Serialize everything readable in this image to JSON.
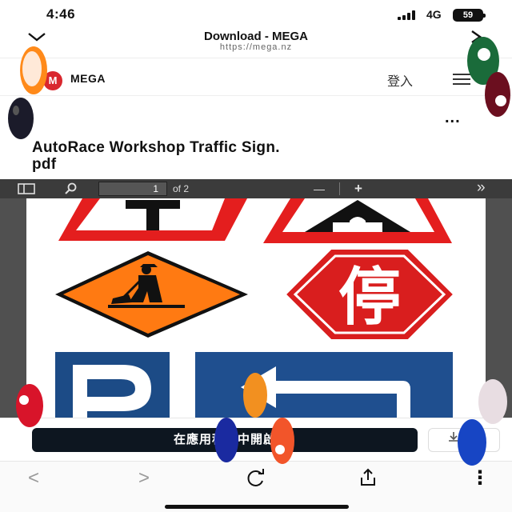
{
  "status_bar": {
    "time": "4:46",
    "network": "4G",
    "battery": "59"
  },
  "browser_header": {
    "title": "Download - MEGA",
    "url": "https://mega.nz",
    "left_icon": "chevron-down-icon",
    "right_icon": "chevron-right-icon"
  },
  "site_nav": {
    "logo_letter": "M",
    "brand": "MEGA",
    "login": "登入",
    "menu_icon": "hamburger-icon"
  },
  "file": {
    "more": "...",
    "title": "AutoRace Workshop Traffic Sign.\npdf"
  },
  "pdf_toolbar": {
    "sidebar_icon": "sidebar-toggle-icon",
    "search_icon": "search-icon",
    "page_number": "1",
    "page_of": "of 2",
    "zoom_out": "—",
    "zoom_in": "+",
    "more": "»"
  },
  "pdf_page": {
    "signs": [
      {
        "name": "T-junction warning sign",
        "glyph": "T"
      },
      {
        "name": "road-narrows warning sign"
      },
      {
        "name": "roadworks sign"
      },
      {
        "name": "stop sign",
        "glyph": "停"
      },
      {
        "name": "parking sign",
        "glyph": "P"
      },
      {
        "name": "turn-left direction sign"
      }
    ],
    "colors": {
      "red": "#e41e1e",
      "orange": "#ff7a12",
      "blue": "#1c4b86",
      "navy": "#1f4f8f"
    }
  },
  "actions": {
    "open_in_app": "在應用程式中開啟",
    "download_icon": "download-icon"
  },
  "browser_bottom": {
    "back": "<",
    "forward": ">",
    "reload_icon": "reload-icon",
    "share_icon": "share-icon",
    "more": "⋮"
  },
  "overlay": {
    "description_icon": "pool-ball-icon"
  }
}
